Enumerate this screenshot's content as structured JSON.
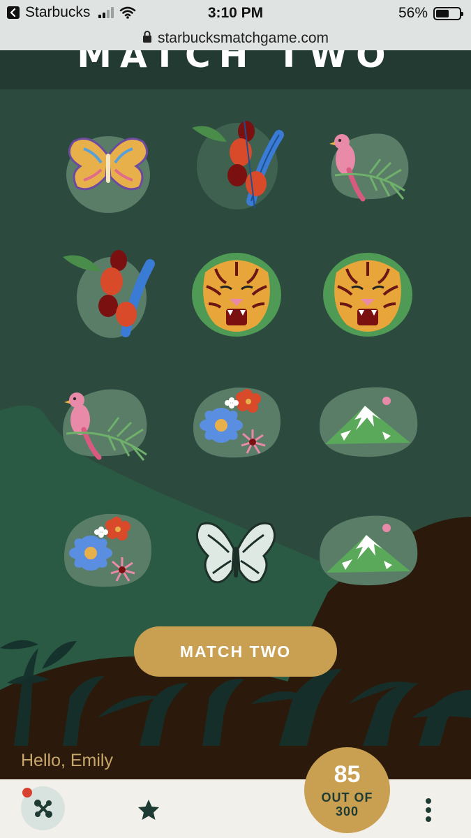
{
  "status_bar": {
    "back_app": "Starbucks",
    "time": "3:10 PM",
    "battery": "56%",
    "battery_level": 0.56
  },
  "browser": {
    "url": "starbucksmatchgame.com"
  },
  "header": {
    "title": "MATCH TWO"
  },
  "cards": [
    {
      "row": 1,
      "col": 1,
      "icon": "butterfly-gold-icon"
    },
    {
      "row": 1,
      "col": 2,
      "icon": "coffee-cherries-icon"
    },
    {
      "row": 1,
      "col": 3,
      "icon": "pink-bird-icon"
    },
    {
      "row": 2,
      "col": 1,
      "icon": "coffee-cherries-icon"
    },
    {
      "row": 2,
      "col": 2,
      "icon": "tiger-icon"
    },
    {
      "row": 2,
      "col": 3,
      "icon": "tiger-icon"
    },
    {
      "row": 3,
      "col": 1,
      "icon": "pink-bird-icon"
    },
    {
      "row": 3,
      "col": 2,
      "icon": "flowers-icon"
    },
    {
      "row": 3,
      "col": 3,
      "icon": "mountain-icon"
    },
    {
      "row": 4,
      "col": 1,
      "icon": "flowers-icon"
    },
    {
      "row": 4,
      "col": 2,
      "icon": "butterfly-outline-icon"
    },
    {
      "row": 4,
      "col": 3,
      "icon": "mountain-icon"
    }
  ],
  "action_button": {
    "label": "MATCH TWO"
  },
  "greeting": "Hello, Emily",
  "score": {
    "value": "85",
    "label_line1": "OUT OF",
    "label_line2": "300"
  },
  "colors": {
    "background": "#2d4a3f",
    "header": "#233a33",
    "gold": "#c9a052",
    "dark_brown": "#2b1a0b",
    "nav_bg": "#f2f0eb"
  }
}
